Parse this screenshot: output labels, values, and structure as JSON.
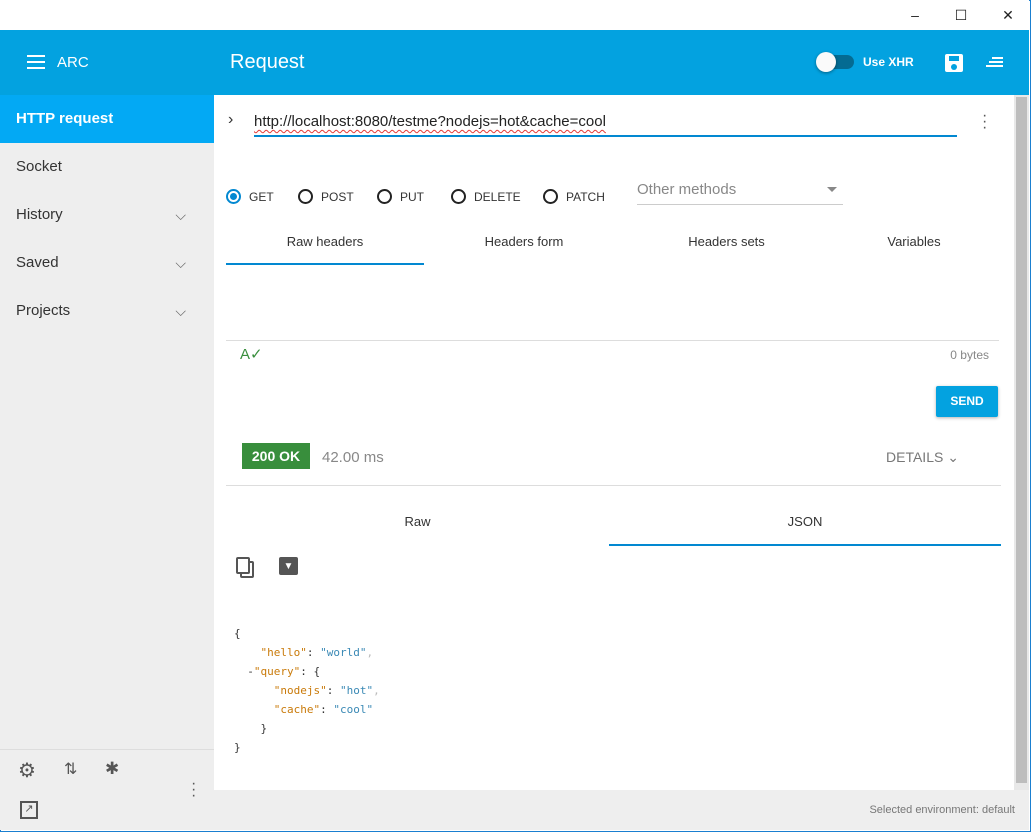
{
  "window": {
    "minimize": "–",
    "maximize": "☐",
    "close": "✕"
  },
  "header": {
    "app_name": "ARC",
    "title": "Request",
    "xhr_label": "Use XHR",
    "xhr_on": false
  },
  "sidebar": {
    "items": [
      {
        "label": "HTTP request"
      },
      {
        "label": "Socket"
      },
      {
        "label": "History"
      },
      {
        "label": "Saved"
      },
      {
        "label": "Projects"
      }
    ]
  },
  "request": {
    "url": "http://localhost:8080/testme?nodejs=hot&cache=cool",
    "methods": [
      "GET",
      "POST",
      "PUT",
      "DELETE",
      "PATCH"
    ],
    "selected_method": "GET",
    "other_methods_placeholder": "Other methods",
    "header_tabs": [
      "Raw headers",
      "Headers form",
      "Headers sets",
      "Variables"
    ],
    "body_size": "0 bytes",
    "send_label": "SEND"
  },
  "response": {
    "status": "200 OK",
    "time": "42.00 ms",
    "details_label": "DETAILS",
    "tabs": [
      "Raw",
      "JSON"
    ],
    "json_lines": {
      "open": "{",
      "hello_key": "\"hello\"",
      "hello_val": "\"world\"",
      "query_key": "\"query\"",
      "nodejs_key": "\"nodejs\"",
      "nodejs_val": "\"hot\"",
      "cache_key": "\"cache\"",
      "cache_val": "\"cool\"",
      "inner_close": "}",
      "close": "}"
    }
  },
  "footer": {
    "environment": "Selected environment: default"
  },
  "colors": {
    "primary": "#03a2e0",
    "selected": "#03a9f4",
    "status_ok": "#388e3c"
  }
}
